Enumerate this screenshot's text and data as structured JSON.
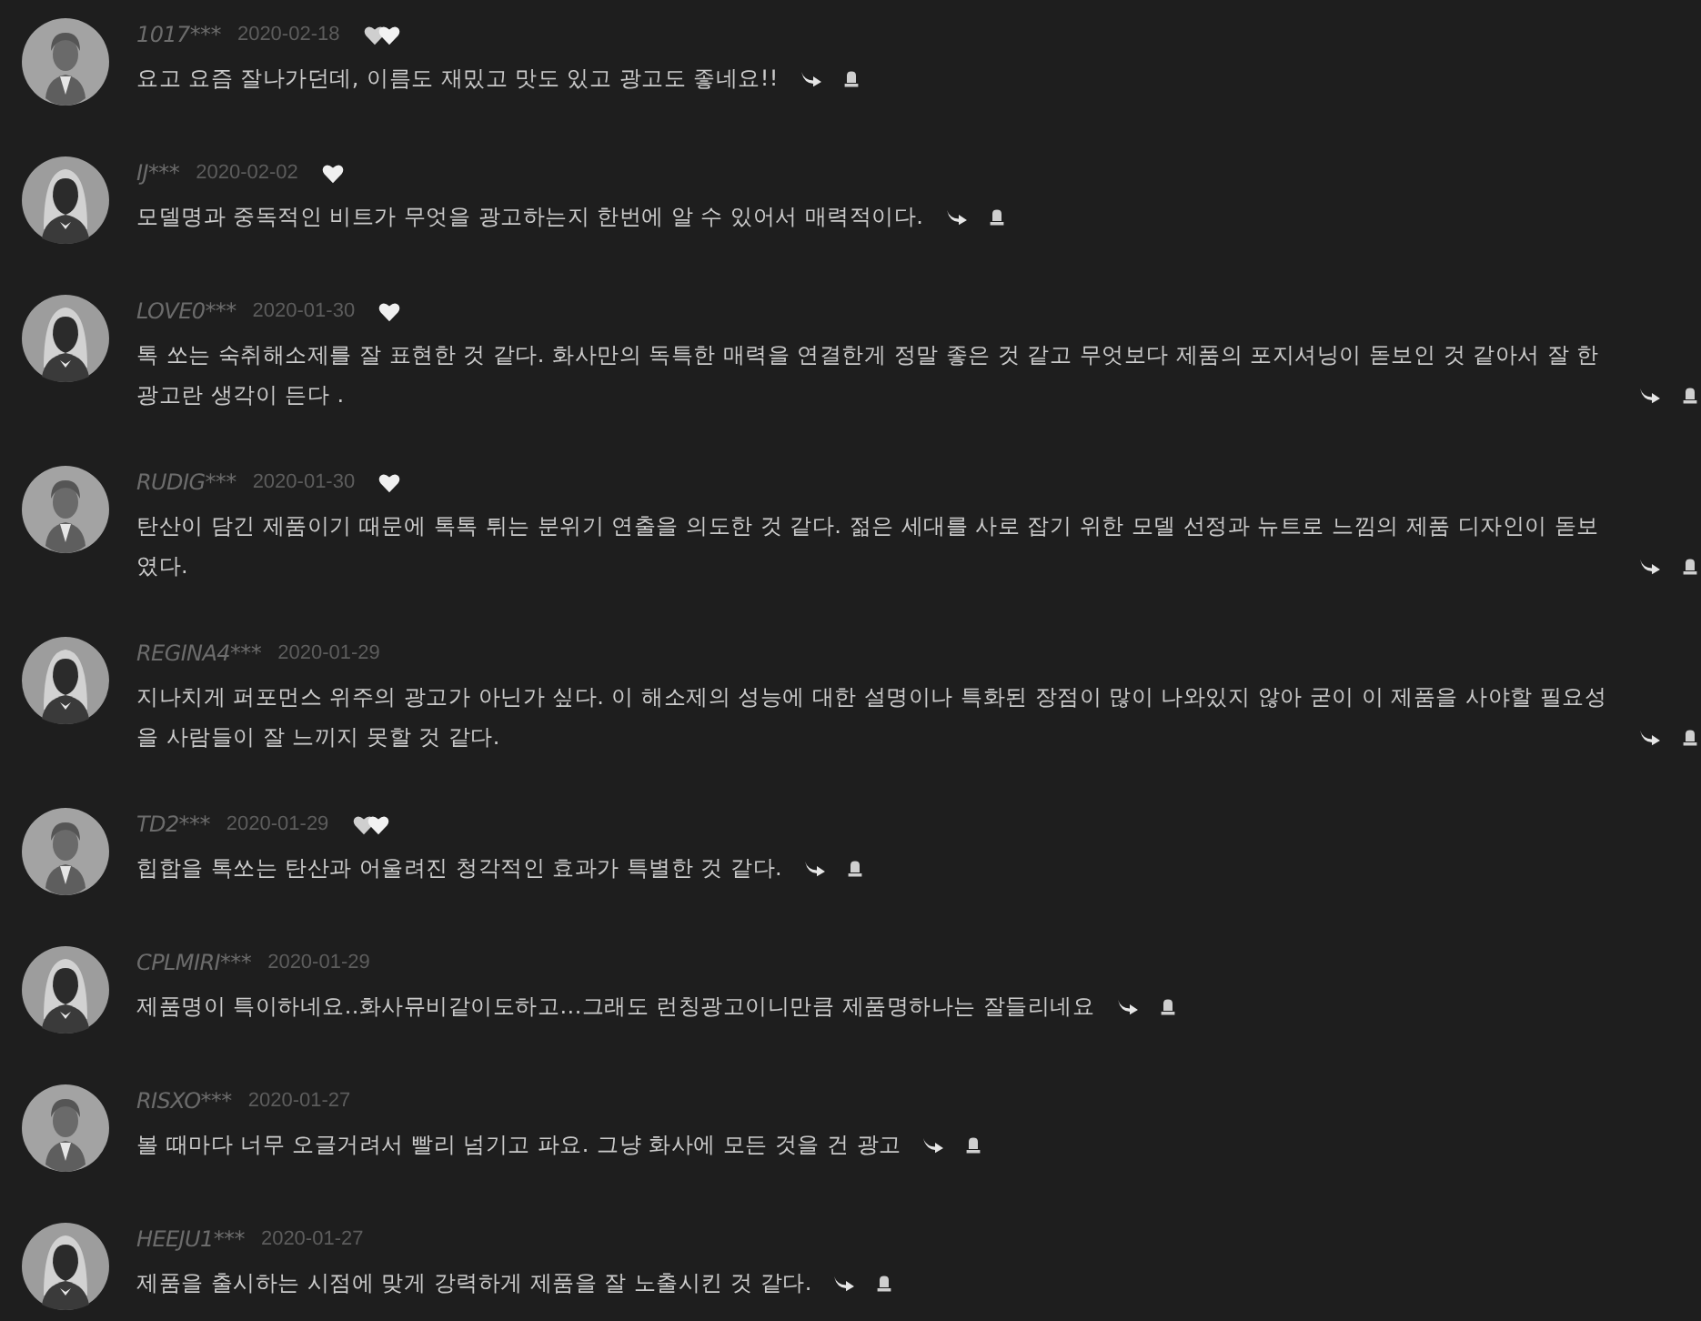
{
  "comments": [
    {
      "user": "1017***",
      "date": "2020-02-18",
      "kind": "shorthair",
      "badge": {
        "kind": "doubleheart"
      },
      "text": "요고 요즘 잘나가던데, 이름도 재밌고 맛도 있고 광고도 좋네요!!"
    },
    {
      "user": "IJ***",
      "date": "2020-02-02",
      "kind": "longhair",
      "badge": {
        "kind": "heart"
      },
      "text": "모델명과 중독적인 비트가 무엇을 광고하는지 한번에 알 수 있어서 매력적이다."
    },
    {
      "user": "LOVE0***",
      "date": "2020-01-30",
      "kind": "longhair",
      "badge": {
        "kind": "heart"
      },
      "text": "톡 쏘는 숙취해소제를 잘 표현한 것 같다. 화사만의 독특한 매력을 연결한게 정말 좋은 것 같고 무엇보다 제품의 포지셔닝이 돋보인 것 같아서 잘 한 광고란 생각이 든다 ."
    },
    {
      "user": "RUDIG***",
      "date": "2020-01-30",
      "kind": "shorthair",
      "badge": {
        "kind": "heart"
      },
      "text": "탄산이 담긴 제품이기 때문에 톡톡 튀는 분위기 연출을 의도한 것 같다. 젊은 세대를 사로 잡기 위한 모델 선정과 뉴트로 느낌의 제품 디자인이 돋보였다."
    },
    {
      "user": "REGINA4***",
      "date": "2020-01-29",
      "kind": "longhair",
      "text": "지나치게 퍼포먼스 위주의 광고가 아닌가 싶다. 이 해소제의 성능에 대한 설명이나 특화된 장점이 많이 나와있지 않아 굳이 이 제품을 사야할 필요성을 사람들이 잘 느끼지 못할 것 같다."
    },
    {
      "user": "TD2***",
      "date": "2020-01-29",
      "kind": "shorthair",
      "badge": {
        "kind": "doubleheart"
      },
      "text": "힙합을 톡쏘는 탄산과 어울려진 청각적인 효과가 특별한 것 같다."
    },
    {
      "user": "CPLMIRI***",
      "date": "2020-01-29",
      "kind": "longhair",
      "text": "제품명이 특이하네요..화사뮤비같이도하고...그래도 런칭광고이니만큼 제품명하나는 잘들리네요"
    },
    {
      "user": "RISXO***",
      "date": "2020-01-27",
      "kind": "shorthair",
      "text": "볼 때마다 너무 오글거려서 빨리 넘기고 파요. 그냥 화사에 모든 것을 건 광고"
    },
    {
      "user": "HEEJU1***",
      "date": "2020-01-27",
      "kind": "longhair",
      "text": "제품을 출시하는 시점에 맞게 강력하게 제품을 잘 노출시킨 것 같다."
    }
  ]
}
